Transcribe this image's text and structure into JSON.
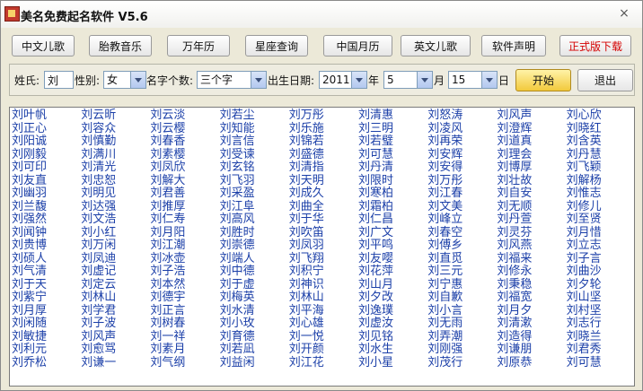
{
  "window": {
    "title": "美名免费起名软件 V5.6",
    "close_symbol": "×"
  },
  "toolbar": [
    {
      "label": "中文儿歌",
      "highlight": false
    },
    {
      "label": "胎教音乐",
      "highlight": false
    },
    {
      "label": "万年历",
      "highlight": false
    },
    {
      "label": "星座查询",
      "highlight": false
    },
    {
      "label": "中国月历",
      "highlight": false
    },
    {
      "label": "英文儿歌",
      "highlight": false
    },
    {
      "label": "软件声明",
      "highlight": false
    },
    {
      "label": "正式版下载",
      "highlight": true
    }
  ],
  "form": {
    "surname_label": "姓氏:",
    "surname_value": "刘",
    "gender_label": "性别:",
    "gender_value": "女",
    "name_length_label": "名字个数:",
    "name_length_value": "三个字",
    "birth_label": "出生日期:",
    "year_value": "2011",
    "year_unit": "年",
    "month_value": "5",
    "month_unit": "月",
    "day_value": "15",
    "day_unit": "日",
    "start_label": "开始",
    "exit_label": "退出"
  },
  "colors": {
    "accent_red": "#d40000",
    "name_text": "#1b3fa8",
    "start_button": "#f2c93c"
  },
  "results": {
    "columns": [
      [
        "刘叶帆",
        "刘正心",
        "刘阳诚",
        "刘刚毅",
        "刘可印",
        "刘友直",
        "刘幽羽",
        "刘兰馥",
        "刘强然",
        "刘闻钟",
        "刘贵博",
        "刘硕人",
        "刘气清",
        "刘于天",
        "刘紫宁",
        "刘月厚",
        "刘闲随",
        "刘敏捷",
        "刘利元",
        "刘乔松"
      ],
      [
        "刘云昕",
        "刘容众",
        "刘慎勤",
        "刘满川",
        "刘清光",
        "刘忠恕",
        "刘明见",
        "刘达强",
        "刘文浩",
        "刘小红",
        "刘万闲",
        "刘凤迪",
        "刘虚记",
        "刘定云",
        "刘林山",
        "刘学君",
        "刘子波",
        "刘风声",
        "刘愈骂",
        "刘谦一"
      ],
      [
        "刘云淡",
        "刘云樱",
        "刘春香",
        "刘素樱",
        "刘凤欣",
        "刘解大",
        "刘君善",
        "刘推厚",
        "刘仁寿",
        "刘月阳",
        "刘江潮",
        "刘冰壶",
        "刘子浩",
        "刘本然",
        "刘德宇",
        "刘正言",
        "刘树春",
        "刘一祥",
        "刘素月",
        "刘气纲"
      ],
      [
        "刘若尘",
        "刘知能",
        "刘言信",
        "刘受谏",
        "刘玄铭",
        "刘飞羽",
        "刘采盈",
        "刘江阜",
        "刘高风",
        "刘胜时",
        "刘崇德",
        "刘端人",
        "刘中德",
        "刘于虚",
        "刘梅英",
        "刘水清",
        "刘小玫",
        "刘育德",
        "刘若凪",
        "刘益闲"
      ],
      [
        "刘万彤",
        "刘乐施",
        "刘锦若",
        "刘盛德",
        "刘清指",
        "刘天明",
        "刘成久",
        "刘曲全",
        "刘于华",
        "刘吹笛",
        "刘凤羽",
        "刘飞翔",
        "刘积宁",
        "刘神识",
        "刘林山",
        "刘平海",
        "刘心雄",
        "刘一悦",
        "刘开颜",
        "刘江花"
      ],
      [
        "刘清惠",
        "刘三明",
        "刘若璧",
        "刘可慧",
        "刘丹清",
        "刘限时",
        "刘寒柏",
        "刘霜柏",
        "刘仁昌",
        "刘广文",
        "刘平鸣",
        "刘友嘤",
        "刘花萍",
        "刘山月",
        "刘夕改",
        "刘逸璞",
        "刘虚汝",
        "刘见铭",
        "刘水生",
        "刘小星"
      ],
      [
        "刘怒涛",
        "刘凌风",
        "刘再荣",
        "刘安辉",
        "刘安得",
        "刘万彤",
        "刘江春",
        "刘文美",
        "刘峰立",
        "刘春空",
        "刘傅乡",
        "刘直觅",
        "刘三元",
        "刘宁惠",
        "刘自歉",
        "刘小言",
        "刘无雨",
        "刘弄潮",
        "刘刚强",
        "刘茂行"
      ],
      [
        "刘风声",
        "刘澄辉",
        "刘道真",
        "刘理会",
        "刘博厚",
        "刘壮故",
        "刘自安",
        "刘无顺",
        "刘丹萱",
        "刘灵芬",
        "刘风燕",
        "刘福来",
        "刘修永",
        "刘秉稳",
        "刘福宽",
        "刘月夕",
        "刘清漱",
        "刘造得",
        "刘谦朋",
        "刘原恭"
      ],
      [
        "刘心欣",
        "刘晓红",
        "刘含英",
        "刘丹慧",
        "刘飞颖",
        "刘解杨",
        "刘惟志",
        "刘修儿",
        "刘至贤",
        "刘月惜",
        "刘立志",
        "刘子言",
        "刘曲沙",
        "刘夕轮",
        "刘山坚",
        "刘村坚",
        "刘志行",
        "刘晓兰",
        "刘君秀",
        "刘可慧"
      ]
    ]
  }
}
